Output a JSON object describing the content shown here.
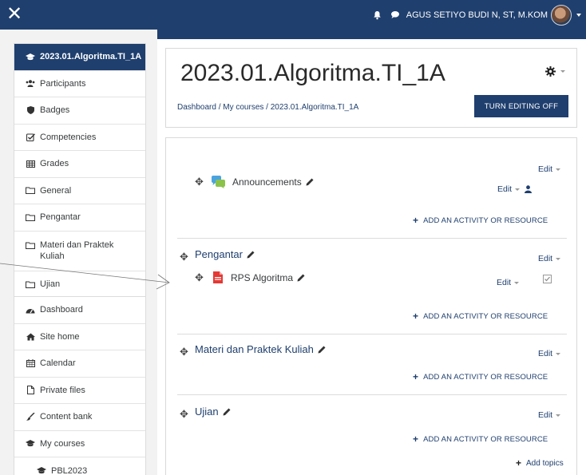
{
  "navbar": {
    "user_name": "AGUS SETIYO BUDI N, ST, M.KOM"
  },
  "sidebar": {
    "course_items": [
      {
        "label": "2023.01.Algoritma.TI_1A",
        "icon": "graduation-cap-icon"
      },
      {
        "label": "Participants",
        "icon": "users-icon"
      },
      {
        "label": "Badges",
        "icon": "shield-icon"
      },
      {
        "label": "Competencies",
        "icon": "checkbox-icon"
      },
      {
        "label": "Grades",
        "icon": "table-icon"
      },
      {
        "label": "General",
        "icon": "folder-icon"
      },
      {
        "label": "Pengantar",
        "icon": "folder-icon"
      },
      {
        "label": "Materi dan Praktek Kuliah",
        "icon": "folder-icon"
      },
      {
        "label": "Ujian",
        "icon": "folder-icon"
      }
    ],
    "site_items": [
      {
        "label": "Dashboard",
        "icon": "dashboard-icon"
      },
      {
        "label": "Site home",
        "icon": "home-icon"
      },
      {
        "label": "Calendar",
        "icon": "calendar-icon"
      },
      {
        "label": "Private files",
        "icon": "file-icon"
      },
      {
        "label": "Content bank",
        "icon": "brush-icon"
      },
      {
        "label": "My courses",
        "icon": "graduation-cap-icon"
      },
      {
        "label": "PBL2023",
        "icon": "graduation-cap-icon"
      }
    ]
  },
  "header": {
    "title": "2023.01.Algoritma.TI_1A",
    "breadcrumb": "Dashboard / My courses / 2023.01.Algoritma.TI_1A",
    "edit_button": "TURN EDITING OFF"
  },
  "sections": {
    "general": {
      "activity": "Announcements",
      "edit": "Edit",
      "activity_edit": "Edit",
      "add": "ADD AN ACTIVITY OR RESOURCE"
    },
    "pengantar": {
      "title": "Pengantar",
      "edit": "Edit",
      "activity": "RPS Algoritma",
      "activity_edit": "Edit",
      "add": "ADD AN ACTIVITY OR RESOURCE"
    },
    "materi": {
      "title": "Materi dan Praktek Kuliah",
      "edit": "Edit",
      "add": "ADD AN ACTIVITY OR RESOURCE"
    },
    "ujian": {
      "title": "Ujian",
      "edit": "Edit",
      "add": "ADD AN ACTIVITY OR RESOURCE"
    },
    "add_topics": "Add topics"
  },
  "colors": {
    "primary": "#1f3f6e",
    "sidebar_bg": "#f2f2f2"
  }
}
